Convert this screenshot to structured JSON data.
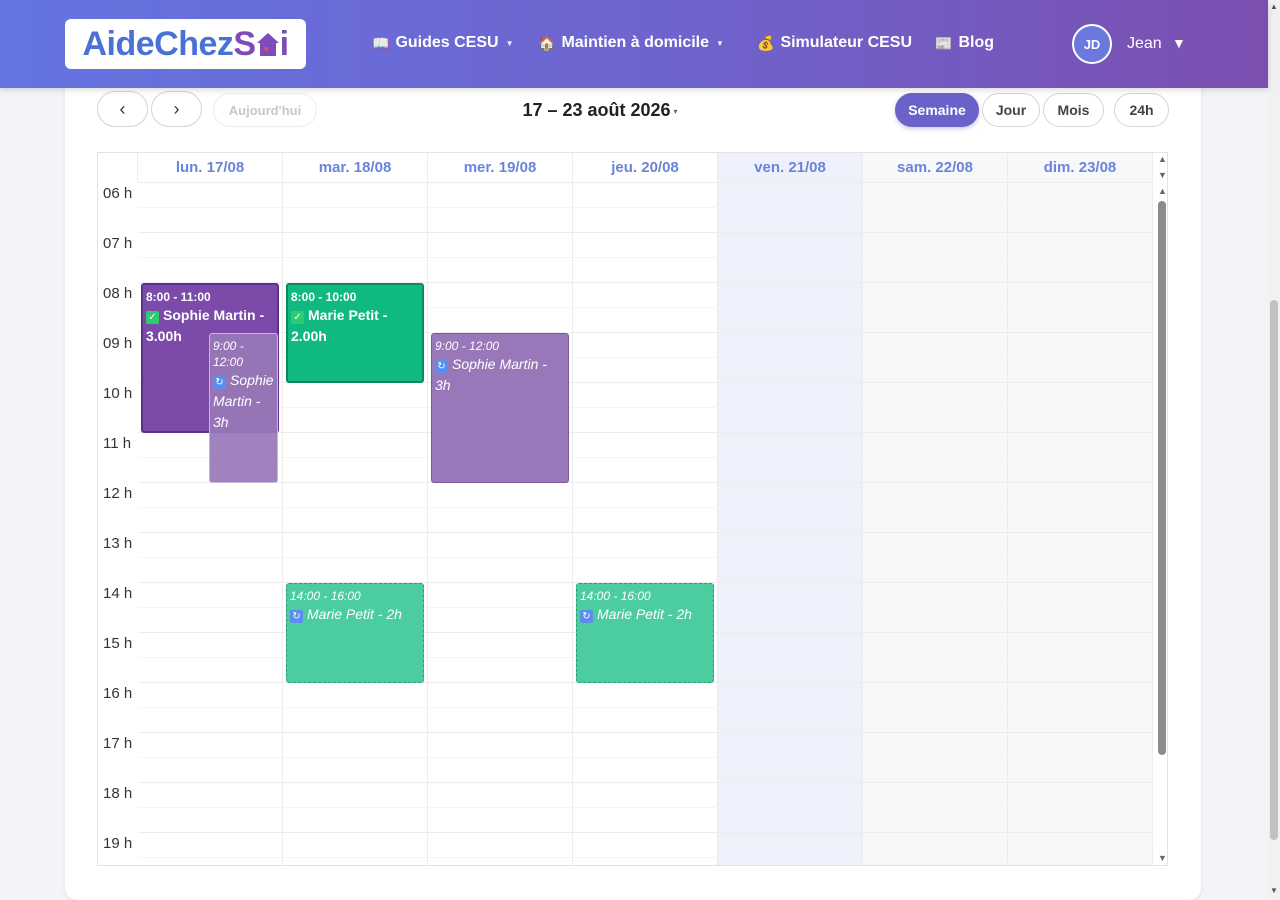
{
  "header": {
    "logo_part1": "AideChez",
    "logo_part2": "S",
    "logo_part3": "i",
    "nav": [
      {
        "icon": "📖",
        "label": "Guides CESU",
        "dropdown": true
      },
      {
        "icon": "🏠",
        "label": "Maintien à domicile",
        "dropdown": true
      },
      {
        "icon": "💰",
        "label": "Simulateur CESU",
        "dropdown": false
      },
      {
        "icon": "📰",
        "label": "Blog",
        "dropdown": false
      }
    ],
    "user": {
      "initials": "JD",
      "name": "Jean",
      "caret": "▼"
    }
  },
  "toolbar": {
    "prev": "‹",
    "next": "›",
    "today": "Aujourd'hui",
    "range": "17 – 23 août 2026",
    "range_caret": "▾",
    "views": [
      {
        "label": "Semaine",
        "active": true
      },
      {
        "label": "Jour",
        "active": false
      },
      {
        "label": "Mois",
        "active": false
      },
      {
        "label": "24h",
        "active": false
      }
    ]
  },
  "calendar": {
    "days": [
      "lun. 17/08",
      "mar. 18/08",
      "mer. 19/08",
      "jeu. 20/08",
      "ven. 21/08",
      "sam. 22/08",
      "dim. 23/08"
    ],
    "hours": [
      "06 h",
      "07 h",
      "08 h",
      "09 h",
      "10 h",
      "11 h",
      "12 h",
      "13 h",
      "14 h",
      "15 h",
      "16 h",
      "17 h",
      "18 h",
      "19 h"
    ],
    "highlight_day": 4,
    "weekend_days": [
      5,
      6
    ],
    "events": [
      {
        "day": 0,
        "start": 8,
        "end": 11,
        "time": "8:00 - 11:00",
        "title": "Sophie Martin - 3.00h",
        "kind": "done-purple",
        "icon": "✓",
        "width": "full"
      },
      {
        "day": 0,
        "start": 9,
        "end": 12,
        "time": "9:00 - 12:00",
        "title": "Sophie Martin - 3h",
        "kind": "plan-purple",
        "icon": "↻",
        "width": "half"
      },
      {
        "day": 1,
        "start": 8,
        "end": 10,
        "time": "8:00 - 10:00",
        "title": "Marie Petit - 2.00h",
        "kind": "done-green",
        "icon": "✓",
        "width": "full"
      },
      {
        "day": 2,
        "start": 9,
        "end": 12,
        "time": "9:00 - 12:00",
        "title": "Sophie Martin - 3h",
        "kind": "plan-purple",
        "icon": "↻",
        "width": "full"
      },
      {
        "day": 1,
        "start": 14,
        "end": 16,
        "time": "14:00 - 16:00",
        "title": "Marie Petit - 2h",
        "kind": "plan-green",
        "icon": "↻",
        "width": "full"
      },
      {
        "day": 3,
        "start": 14,
        "end": 16,
        "time": "14:00 - 16:00",
        "title": "Marie Petit - 2h",
        "kind": "plan-green",
        "icon": "↻",
        "width": "full"
      }
    ]
  },
  "colors": {
    "header_start": "#6474e2",
    "header_end": "#7b4fb0",
    "accent": "#6b62c9",
    "done_purple": "#7c4aa8",
    "done_green": "#10b981",
    "planned_purple": "#9878b8",
    "planned_green": "#4ccda0",
    "highlight_day_bg": "#eef1fb",
    "weekend_bg": "#f6f8f9"
  }
}
